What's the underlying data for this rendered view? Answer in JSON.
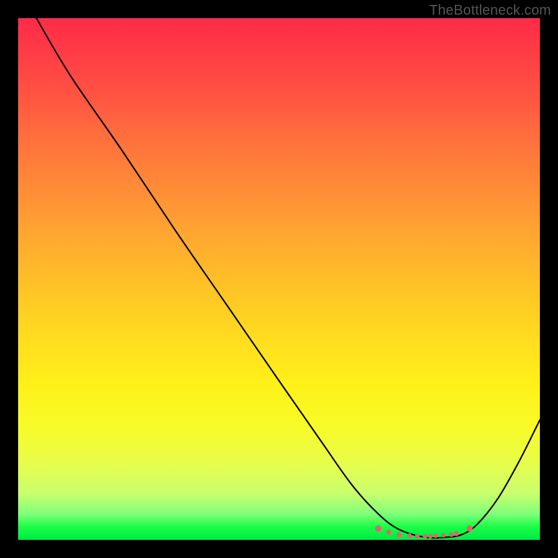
{
  "watermark": "TheBottleneck.com",
  "chart_data": {
    "type": "line",
    "title": "",
    "xlabel": "",
    "ylabel": "",
    "xlim": [
      0,
      100
    ],
    "ylim": [
      0,
      100
    ],
    "grid": false,
    "series": [
      {
        "name": "curve",
        "color": "#000000",
        "x": [
          3.5,
          10,
          20,
          30,
          40,
          50,
          58,
          64,
          69,
          73,
          78,
          82,
          85,
          88,
          92,
          96,
          100
        ],
        "y": [
          100,
          89,
          74.5,
          59.5,
          45,
          30.5,
          19,
          10.5,
          5,
          2,
          0.5,
          0.5,
          1,
          3,
          8,
          15,
          23
        ]
      }
    ],
    "markers": {
      "color": "#d86a6a",
      "x": [
        69,
        71,
        73,
        75,
        76.5,
        78,
        79,
        80,
        81.5,
        83,
        84,
        86.5
      ],
      "y": [
        2.2,
        1.5,
        1.0,
        0.8,
        0.7,
        0.7,
        0.7,
        0.8,
        0.9,
        1.0,
        1.2,
        2.2
      ],
      "r": [
        4.5,
        3.6,
        3.6,
        3.6,
        3.4,
        3.4,
        3.4,
        3.4,
        3.4,
        3.4,
        3.6,
        4.5
      ]
    },
    "gradient_stops": [
      {
        "pos": 0,
        "color": "#ff2b47"
      },
      {
        "pos": 50,
        "color": "#ffc426"
      },
      {
        "pos": 78,
        "color": "#f8fb27"
      },
      {
        "pos": 100,
        "color": "#00e84a"
      }
    ]
  }
}
